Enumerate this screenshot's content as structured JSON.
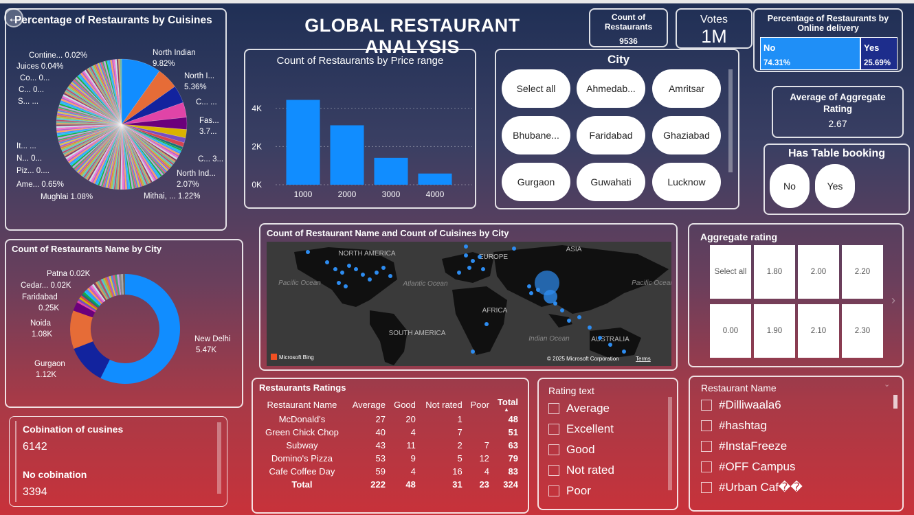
{
  "header": {
    "title": "GLOBAL RESTAURANT ANALYSIS",
    "back_icon": "arrow-left-icon"
  },
  "cuisine_pie": {
    "title": "Percentage of Restaurants by Cuisines",
    "labels": [
      {
        "t1": "North Indian",
        "t2": "9.82%"
      },
      {
        "t1": "North I...",
        "t2": "5.36%"
      },
      {
        "t1": "C... ...",
        "t2": ""
      },
      {
        "t1": "Fas...",
        "t2": "3.7..."
      },
      {
        "t1": "C... 3...",
        "t2": ""
      },
      {
        "t1": "North Ind...",
        "t2": "2.07%"
      },
      {
        "t1": "Mithai, ... 1.22%",
        "t2": ""
      },
      {
        "t1": "Mughlai 1.08%",
        "t2": ""
      },
      {
        "t1": "Ame... 0.65%",
        "t2": ""
      },
      {
        "t1": "Piz... 0....",
        "t2": ""
      },
      {
        "t1": "N... 0...",
        "t2": ""
      },
      {
        "t1": "It... ...",
        "t2": ""
      },
      {
        "t1": "S... ...",
        "t2": ""
      },
      {
        "t1": "C... 0...",
        "t2": ""
      },
      {
        "t1": "Co... 0...",
        "t2": ""
      },
      {
        "t1": "Juices 0.04%",
        "t2": ""
      },
      {
        "t1": "Contine... 0.02%",
        "t2": ""
      }
    ],
    "slices": [
      9.82,
      5.36,
      4.4,
      3.7,
      3.0,
      2.07,
      1.22,
      1.08,
      0.65
    ]
  },
  "price_chart": {
    "title": "Count of Restaurants by Price range",
    "y_ticks": [
      "4K",
      "2K",
      "0K"
    ]
  },
  "chart_data": {
    "type": "bar",
    "title": "Count of Restaurants by Price range",
    "categories": [
      "1000",
      "2000",
      "3000",
      "4000"
    ],
    "values": [
      4444,
      3113,
      1408,
      586
    ],
    "ylim": [
      0,
      5000
    ],
    "xlabel": "",
    "ylabel": ""
  },
  "kpis": {
    "count_title": "Count of Restaurants",
    "count_value": "9536",
    "votes_title": "Votes",
    "votes_value": "1M",
    "online_title": "Percentage of Restaurants by Online delivery",
    "online_no_label": "No",
    "online_no_value": "74.31%",
    "online_no_fraction": 0.7431,
    "online_yes_label": "Yes",
    "online_yes_value": "25.69%",
    "avg_title": "Average of Aggregate Rating",
    "avg_value": "2.67"
  },
  "city_slicer": {
    "title": "City",
    "options": [
      "Select all",
      "Ahmedab...",
      "Amritsar",
      "Bhubane...",
      "Faridabad",
      "Ghaziabad",
      "Gurgaon",
      "Guwahati",
      "Lucknow"
    ]
  },
  "table_booking": {
    "title": "Has Table booking",
    "options": [
      "No",
      "Yes"
    ]
  },
  "city_donut": {
    "title": "Count of Restaurants Name by City",
    "labels": [
      {
        "t1": "Patna 0.02K",
        "t2": ""
      },
      {
        "t1": "Cedar... 0.02K",
        "t2": ""
      },
      {
        "t1": "Faridabad",
        "t2": "0.25K"
      },
      {
        "t1": "Noida",
        "t2": "1.08K"
      },
      {
        "t1": "Gurgaon",
        "t2": "1.12K"
      },
      {
        "t1": "New Delhi",
        "t2": "5.47K"
      }
    ],
    "values": [
      5.47,
      1.12,
      1.08,
      0.25
    ]
  },
  "map": {
    "title": "Count of Restaurant Name and Count of Cuisines by City",
    "continents": [
      "NORTH AMERICA",
      "EUROPE",
      "ASIA",
      "AFRICA",
      "SOUTH AMERICA",
      "AUSTRALIA"
    ],
    "oceans": [
      "Pacific Ocean",
      "Atlantic Ocean",
      "Pacific Ocean",
      "Indian Ocean"
    ],
    "brand": "Microsoft Bing",
    "copyright": "© 2025 Microsoft Corporation",
    "terms": "Terms"
  },
  "aggregate_rating": {
    "title": "Aggregate rating",
    "cells": [
      "Select all",
      "1.80",
      "2.00",
      "2.20",
      "0.00",
      "1.90",
      "2.10",
      "2.30"
    ]
  },
  "combination": {
    "label1": "Cobination of cusines",
    "value1": "6142",
    "label2": "No cobination",
    "value2": "3394"
  },
  "ratings_table": {
    "title": "Restaurants Ratings",
    "headers": [
      "Restaurant Name",
      "Average",
      "Good",
      "Not rated",
      "Poor",
      "Total"
    ],
    "rows": [
      [
        "McDonald's",
        "27",
        "20",
        "1",
        "",
        "48"
      ],
      [
        "Green Chick Chop",
        "40",
        "4",
        "7",
        "",
        "51"
      ],
      [
        "Subway",
        "43",
        "11",
        "2",
        "7",
        "63"
      ],
      [
        "Domino's Pizza",
        "53",
        "9",
        "5",
        "12",
        "79"
      ],
      [
        "Cafe Coffee Day",
        "59",
        "4",
        "16",
        "4",
        "83"
      ]
    ],
    "total": [
      "Total",
      "222",
      "48",
      "31",
      "23",
      "324"
    ]
  },
  "rating_text": {
    "title": "Rating text",
    "options": [
      "Average",
      "Excellent",
      "Good",
      "Not rated",
      "Poor"
    ]
  },
  "restaurant_name": {
    "title": "Restaurant Name",
    "options": [
      "#Dilliwaala6",
      "#hashtag",
      "#InstaFreeze",
      "#OFF Campus",
      "#Urban Caf��"
    ]
  }
}
